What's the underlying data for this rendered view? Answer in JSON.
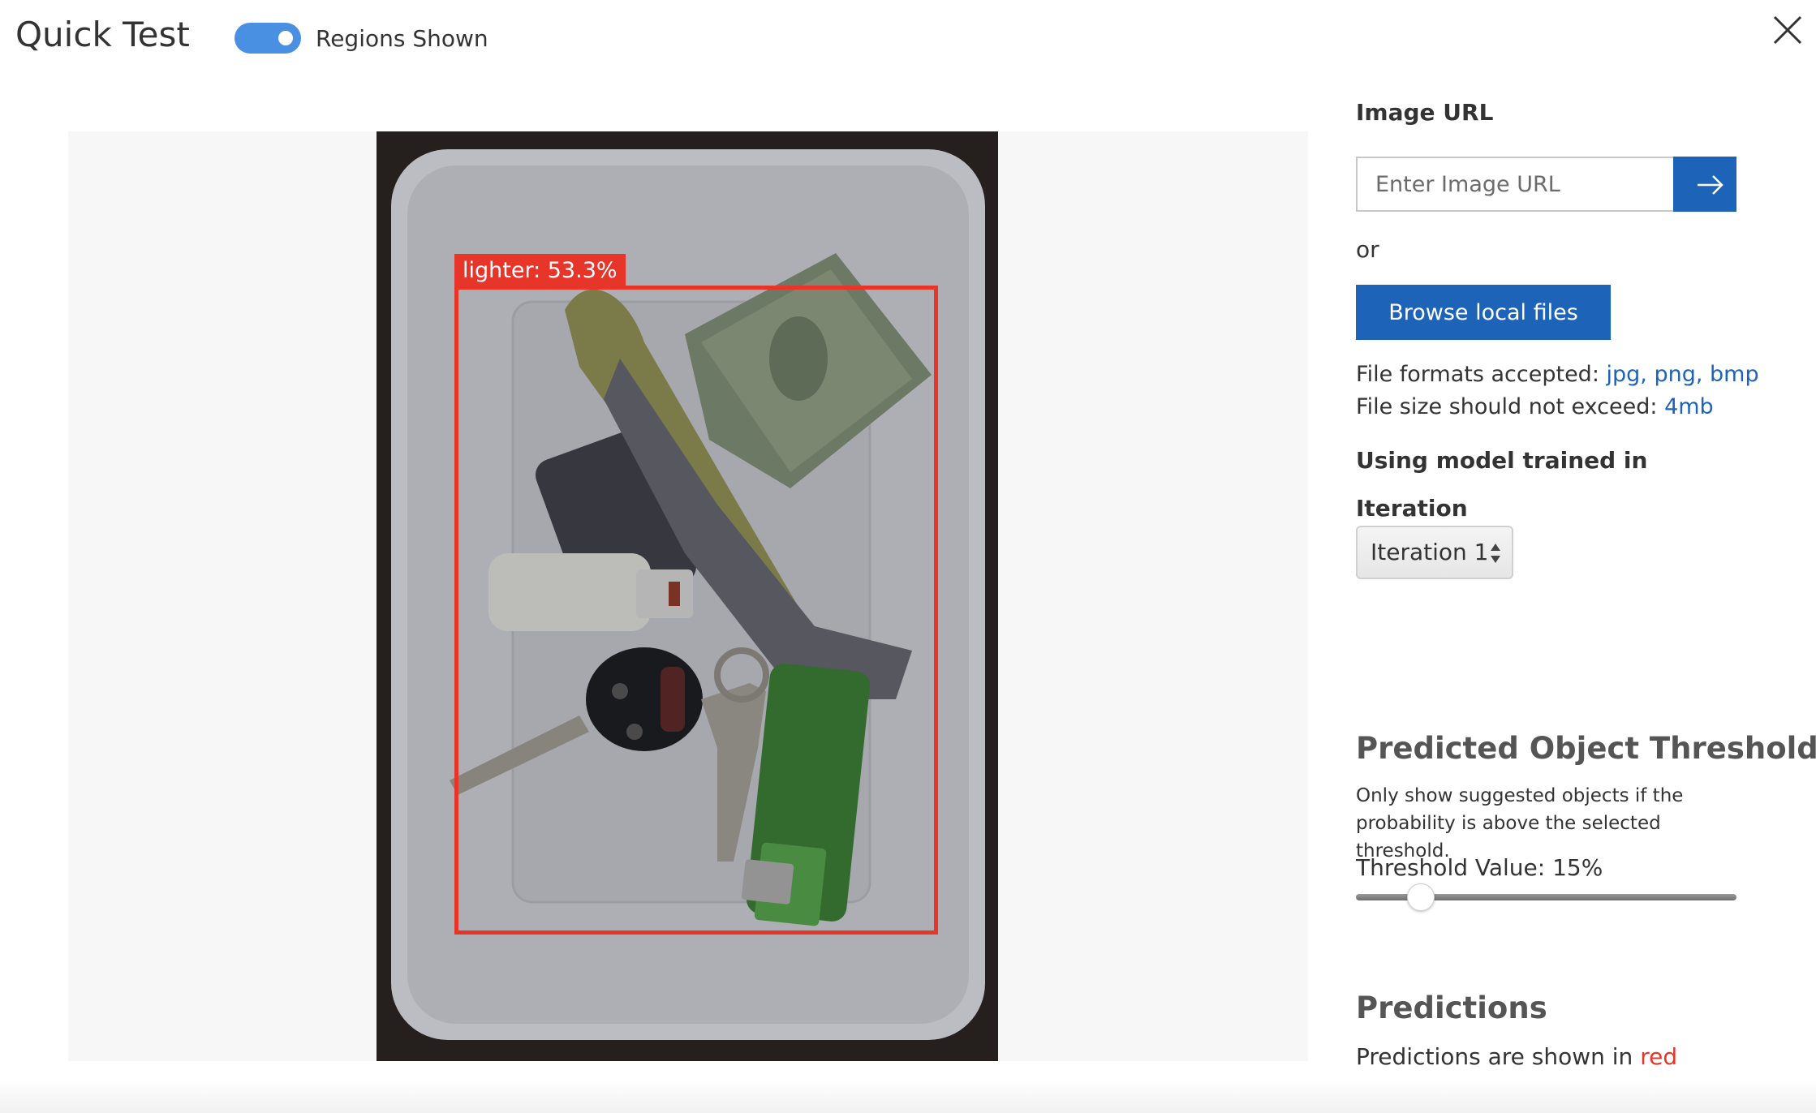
{
  "header": {
    "title": "Quick Test",
    "toggle_label": "Regions Shown",
    "toggle_on": true
  },
  "preview": {
    "region": {
      "label": "lighter: 53.3%",
      "color": "#e8352a"
    }
  },
  "panel": {
    "image_url_heading": "Image URL",
    "url_placeholder": "Enter Image URL",
    "url_value": "",
    "or_text": "or",
    "browse_label": "Browse local files",
    "formats_prefix": "File formats accepted: ",
    "formats_value": "jpg, png, bmp",
    "size_prefix": "File size should not exceed: ",
    "size_value": "4mb",
    "model_heading": "Using model trained in",
    "iteration_heading": "Iteration",
    "iteration_selected": "Iteration 1",
    "threshold_title": "Predicted Object Threshold",
    "threshold_desc_line1": "Only show suggested objects if the",
    "threshold_desc_line2": "probability is above the selected threshold.",
    "threshold_label": "Threshold Value: 15%",
    "threshold_fraction": 0.15,
    "predictions_title": "Predictions",
    "predictions_prefix": "Predictions are shown in ",
    "predictions_color_word": "red"
  },
  "icons": {
    "close": "close-icon",
    "go": "arrow-right-icon",
    "select": "updown-arrows-icon"
  },
  "colors": {
    "accent": "#1d63b8",
    "toggle": "#4a90e2",
    "prediction": "#e8352a"
  }
}
